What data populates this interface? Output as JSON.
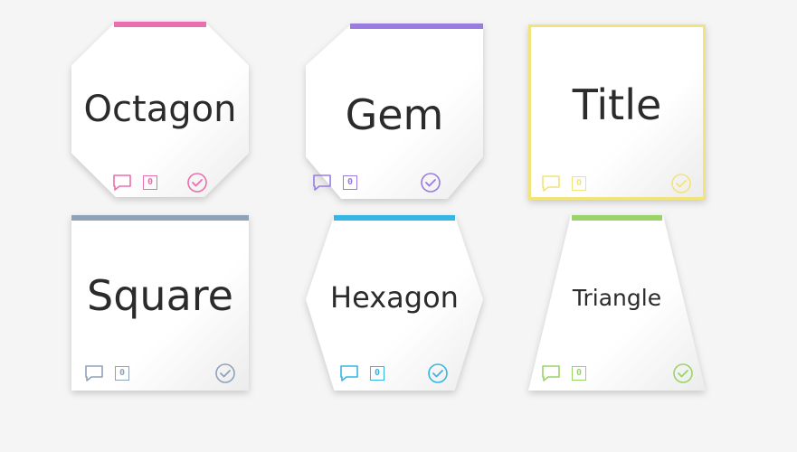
{
  "cards": [
    {
      "title": "Octagon",
      "shape": "octagon",
      "accent": "#ea6fae",
      "comment_count": "0",
      "icons": [
        "comment-icon",
        "count-badge",
        "check-circle-icon"
      ]
    },
    {
      "title": "Gem",
      "shape": "gem",
      "accent": "#9a7be0",
      "comment_count": "0",
      "icons": [
        "comment-icon",
        "count-badge",
        "check-circle-icon"
      ]
    },
    {
      "title": "Title",
      "shape": "square-bordered",
      "accent": "#f2e37a",
      "comment_count": "0",
      "icons": [
        "comment-icon",
        "count-badge",
        "check-circle-icon"
      ]
    },
    {
      "title": "Square",
      "shape": "square",
      "accent": "#8fa2b8",
      "comment_count": "0",
      "icons": [
        "comment-icon",
        "count-badge",
        "check-circle-icon"
      ]
    },
    {
      "title": "Hexagon",
      "shape": "hexagon",
      "accent": "#35b6e3",
      "comment_count": "0",
      "icons": [
        "comment-icon",
        "count-badge",
        "check-circle-icon"
      ]
    },
    {
      "title": "Triangle",
      "shape": "triangle",
      "accent": "#9ad469",
      "comment_count": "0",
      "icons": [
        "comment-icon",
        "count-badge",
        "check-circle-icon"
      ]
    }
  ]
}
